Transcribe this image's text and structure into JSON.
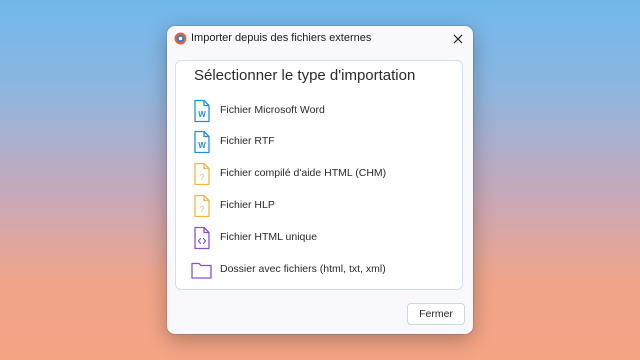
{
  "dialog": {
    "title": "Importer depuis des fichiers externes",
    "app_icon": "app-logo-icon",
    "close_icon": "close-icon"
  },
  "panel": {
    "heading": "Sélectionner le type d'importation",
    "options": [
      {
        "label": "Fichier Microsoft Word",
        "icon": "word-file-icon",
        "color": "#1f8fe0"
      },
      {
        "label": "Fichier RTF",
        "icon": "rtf-file-icon",
        "color": "#1f8fe0"
      },
      {
        "label": "Fichier compilé d'aide HTML (CHM)",
        "icon": "chm-help-file-icon",
        "color": "#f0b93a"
      },
      {
        "label": "Fichier HLP",
        "icon": "hlp-help-file-icon",
        "color": "#f0b93a"
      },
      {
        "label": "Fichier HTML unique",
        "icon": "html-file-icon",
        "color": "#8a4fd8"
      },
      {
        "label": "Dossier avec fichiers (html, txt, xml)",
        "icon": "folder-icon",
        "color": "#8a4fd8"
      }
    ]
  },
  "footer": {
    "close_label": "Fermer"
  }
}
